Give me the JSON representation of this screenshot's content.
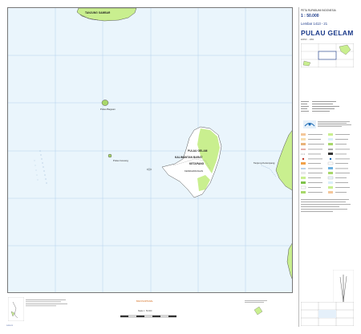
{
  "legend": {
    "series": "PETA RUPABUMI INDONESIA",
    "scale": "1 : 50.000",
    "sheet": "Lembar 1413 - 21",
    "title": "PULAU GELAM",
    "edition": "EDISI I - 1991"
  },
  "map": {
    "place_labels": [
      {
        "id": "top",
        "text": "TANJUNG SAMBAR"
      },
      {
        "id": "w1",
        "text": "Pulau Baguan"
      },
      {
        "id": "w2",
        "text": "Pulau Gosong"
      },
      {
        "id": "n1",
        "text": "PULAU GELAM"
      },
      {
        "id": "n2",
        "text": "KALIMANTAN BARAT"
      },
      {
        "id": "n3",
        "text": "KETAPANG"
      },
      {
        "id": "n4",
        "text": "KENDAWANGAN"
      },
      {
        "id": "e1",
        "text": "Tanjung Kelumpang"
      }
    ],
    "colors": {
      "sea": "#eaf5fc",
      "land": "#c9ef8f",
      "land_dark": "#a8d86a",
      "coast": "#555555",
      "grid": "#a8c8e8",
      "contour": "#7aa0c8"
    }
  },
  "footer": {
    "scale_bar": "Skala 1 : 50.000",
    "orange_note": "BAKOSURTANAL",
    "corner_code": "1413-21"
  }
}
